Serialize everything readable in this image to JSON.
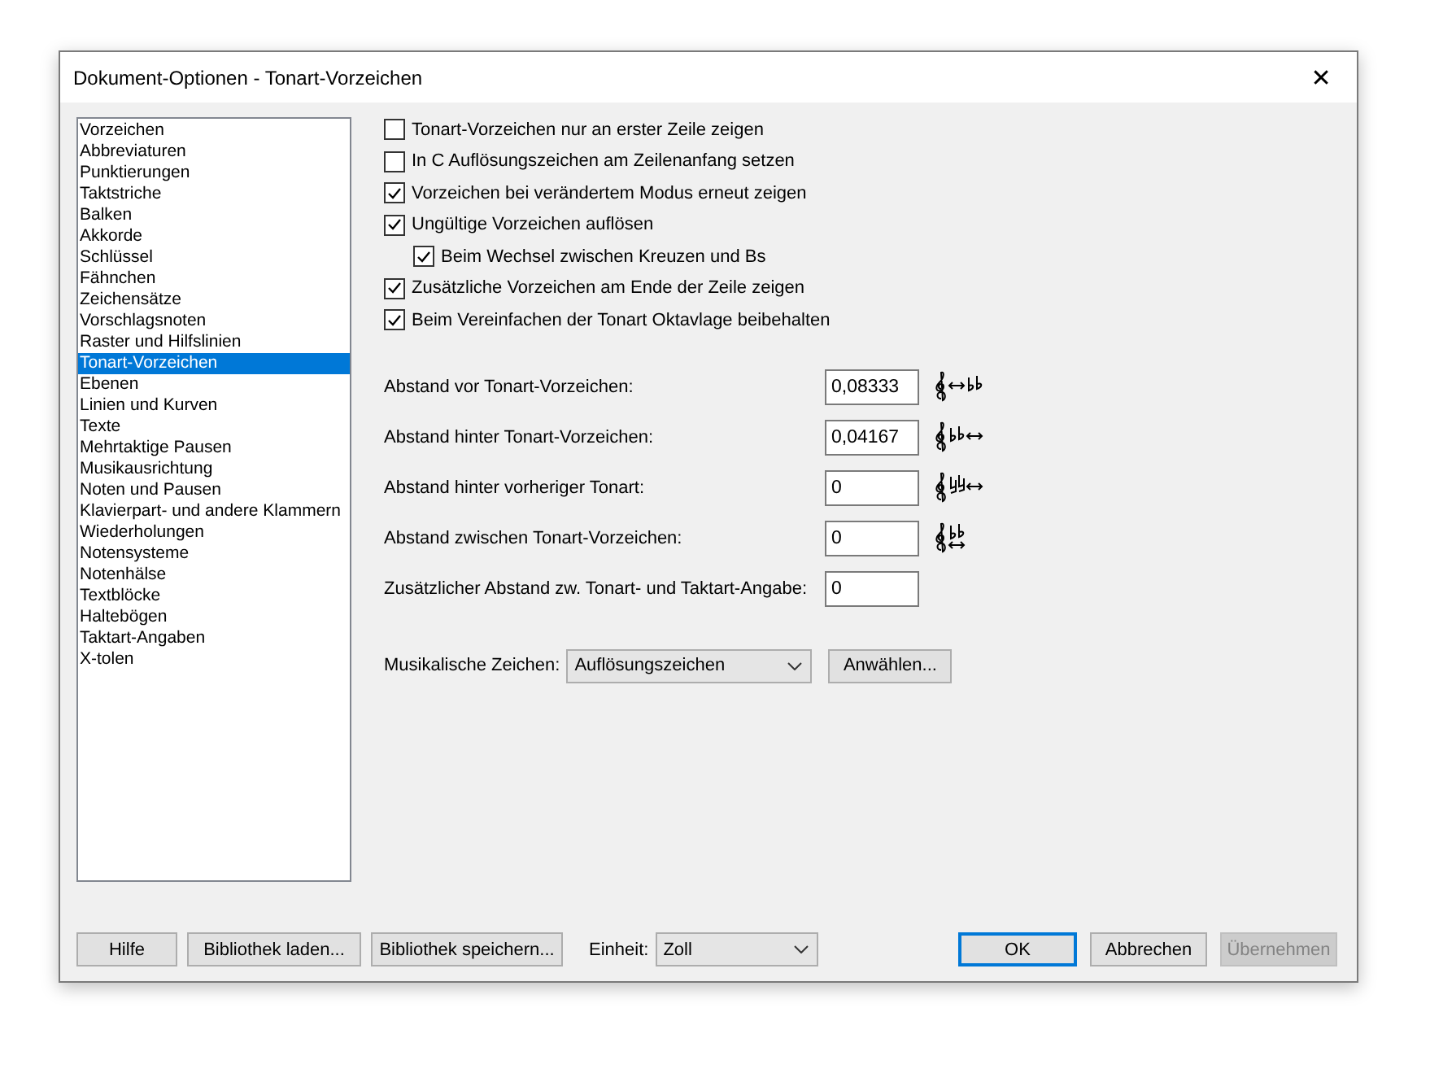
{
  "window": {
    "title": "Dokument-Optionen - Tonart-Vorzeichen",
    "close": "✕"
  },
  "categories": [
    {
      "label": "Vorzeichen",
      "selected": false
    },
    {
      "label": "Abbreviaturen",
      "selected": false
    },
    {
      "label": "Punktierungen",
      "selected": false
    },
    {
      "label": "Taktstriche",
      "selected": false
    },
    {
      "label": "Balken",
      "selected": false
    },
    {
      "label": "Akkorde",
      "selected": false
    },
    {
      "label": "Schlüssel",
      "selected": false
    },
    {
      "label": "Fähnchen",
      "selected": false
    },
    {
      "label": "Zeichensätze",
      "selected": false
    },
    {
      "label": "Vorschlagsnoten",
      "selected": false
    },
    {
      "label": "Raster und Hilfslinien",
      "selected": false
    },
    {
      "label": "Tonart-Vorzeichen",
      "selected": true
    },
    {
      "label": "Ebenen",
      "selected": false
    },
    {
      "label": "Linien und Kurven",
      "selected": false
    },
    {
      "label": "Texte",
      "selected": false
    },
    {
      "label": "Mehrtaktige Pausen",
      "selected": false
    },
    {
      "label": "Musikausrichtung",
      "selected": false
    },
    {
      "label": "Noten und Pausen",
      "selected": false
    },
    {
      "label": "Klavierpart- und andere Klammern",
      "selected": false
    },
    {
      "label": "Wiederholungen",
      "selected": false
    },
    {
      "label": "Notensysteme",
      "selected": false
    },
    {
      "label": "Notenhälse",
      "selected": false
    },
    {
      "label": "Textblöcke",
      "selected": false
    },
    {
      "label": "Haltebögen",
      "selected": false
    },
    {
      "label": "Taktart-Angaben",
      "selected": false
    },
    {
      "label": "X-tolen",
      "selected": false
    }
  ],
  "options": [
    {
      "label": "Tonart-Vorzeichen nur an erster Zeile zeigen",
      "checked": false
    },
    {
      "label": "In C Auflösungszeichen am Zeilenanfang setzen",
      "checked": false
    },
    {
      "label": "Vorzeichen bei verändertem Modus erneut zeigen",
      "checked": true
    },
    {
      "label": "Ungültige Vorzeichen auflösen",
      "checked": true,
      "children": [
        {
          "label": "Beim Wechsel zwischen Kreuzen und Bs",
          "checked": true
        }
      ]
    },
    {
      "label": "Zusätzliche Vorzeichen am Ende der Zeile zeigen",
      "checked": true
    },
    {
      "label": "Beim Vereinfachen der Tonart Oktavlage beibehalten",
      "checked": true
    }
  ],
  "spacings": [
    {
      "label": "Abstand vor Tonart-Vorzeichen:",
      "value": "0,08333",
      "kind": "before"
    },
    {
      "label": "Abstand hinter Tonart-Vorzeichen:",
      "value": "0,04167",
      "kind": "after"
    },
    {
      "label": "Abstand hinter vorheriger Tonart:",
      "value": "0",
      "kind": "naturals"
    },
    {
      "label": "Abstand zwischen Tonart-Vorzeichen:",
      "value": "0",
      "kind": "between"
    },
    {
      "label": "Zusätzlicher Abstand zw. Tonart- und Taktart-Angabe:",
      "value": "0",
      "kind": "none"
    }
  ],
  "symbols": {
    "label": "Musikalische Zeichen:",
    "value": "Auflösungszeichen",
    "button": "Anwählen..."
  },
  "footer": {
    "buttons": [
      {
        "label": "Hilfe"
      },
      {
        "label": "Bibliothek laden..."
      },
      {
        "label": "Bibliothek speichern..."
      }
    ],
    "unit_label": "Einheit:",
    "unit": "Zoll",
    "ok": "OK",
    "cancel": "Abbrechen",
    "apply": {
      "label": "Übernehmen",
      "disabled": true
    }
  }
}
